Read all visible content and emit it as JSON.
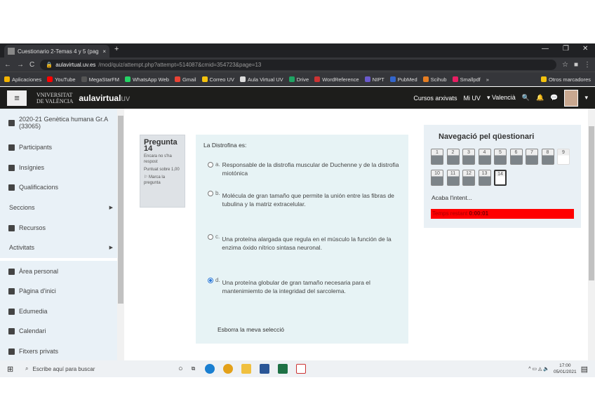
{
  "browser": {
    "tab_title": "Cuestionario 2-Temas 4 y 5 (pag",
    "url_host": "aulavirtual.uv.es",
    "url_path": "/mod/quiz/attempt.php?attempt=514087&cmid=354723&page=13",
    "bookmarks": [
      "Aplicaciones",
      "YouTube",
      "MegaStarFM",
      "WhatsApp Web",
      "Gmail",
      "Correo UV",
      "Aula Virtual UV",
      "Drive",
      "WordReference",
      "NIPT",
      "PubMed",
      "Scihub",
      "Smallpdf",
      "»",
      "Otros marcadores"
    ]
  },
  "navbar": {
    "uv_logo_line1": "VNIVERSITAT",
    "uv_logo_line2": "DE VALÈNCIA",
    "aula_a": "aula",
    "aula_b": "virtual",
    "aula_c": "uv",
    "archived": "Cursos arxivats",
    "miuv": "Mi UV",
    "lang": "▾ Valencià"
  },
  "sidebar": {
    "items": [
      {
        "label": "2020-21 Genètica humana Gr.A (33065)"
      },
      {
        "label": "Participants"
      },
      {
        "label": "Insígnies"
      },
      {
        "label": "Qualificacions"
      },
      {
        "label": "Seccions"
      },
      {
        "label": "Recursos"
      },
      {
        "label": "Activitats"
      },
      {
        "label": "Àrea personal"
      },
      {
        "label": "Pàgina d'inici"
      },
      {
        "label": "Edumedia"
      },
      {
        "label": "Calendari"
      },
      {
        "label": "Fitxers privats"
      }
    ]
  },
  "question": {
    "label": "Pregunta",
    "number": "14",
    "status": "Encara no s'ha respost",
    "points": "Puntuat sobre 1,00",
    "flag": "Marca la pregunta",
    "text": "La Distrofina es:",
    "options": [
      {
        "letter": "a.",
        "text": "Responsable de la distrofia muscular de Duchenne y de la distrofia miotónica",
        "selected": false
      },
      {
        "letter": "b.",
        "text": "Molécula de gran tamaño que permite la unión entre las fibras de tubulina y la matriz extracelular.",
        "selected": false
      },
      {
        "letter": "c.",
        "text": "Una proteína alargada que regula en el músculo la función de la enzima óxido nítrico sintasa neuronal.",
        "selected": false
      },
      {
        "letter": "d.",
        "text": "Una proteína globular de gran tamaño necesaria para el mantenimiemto de la integridad del sarcolema.",
        "selected": true
      }
    ],
    "clear": "Esborra la meva selecció"
  },
  "quiznav": {
    "title": "Navegació pel qüestionari",
    "buttons": [
      "1",
      "2",
      "3",
      "4",
      "5",
      "6",
      "7",
      "8",
      "9",
      "10",
      "11",
      "12",
      "13",
      "14"
    ],
    "finish": "Acaba l'intent...",
    "timer_label": "Temps restant",
    "timer_value": "0:00:01"
  },
  "taskbar": {
    "search": "Escribe aquí para buscar",
    "time": "17:00",
    "date": "05/01/2021"
  }
}
